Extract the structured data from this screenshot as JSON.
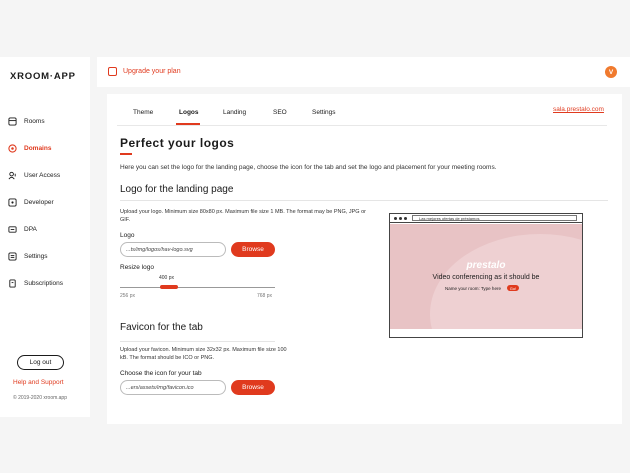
{
  "app": {
    "logo": "XROOM·APP",
    "copyright": "© 2019-2020 xroom.app"
  },
  "sidebar": {
    "items": [
      {
        "label": "Rooms",
        "icon": "rooms-icon",
        "active": false
      },
      {
        "label": "Domains",
        "icon": "domains-icon",
        "active": true
      },
      {
        "label": "User Access",
        "icon": "user-access-icon",
        "active": false
      },
      {
        "label": "Developer",
        "icon": "developer-icon",
        "active": false
      },
      {
        "label": "DPA",
        "icon": "dpa-icon",
        "active": false
      },
      {
        "label": "Settings",
        "icon": "settings-icon",
        "active": false
      },
      {
        "label": "Subscriptions",
        "icon": "subscriptions-icon",
        "active": false
      }
    ],
    "logout_label": "Log out",
    "help_label": "Help and Support"
  },
  "topbar": {
    "upgrade_label": "Upgrade your plan",
    "avatar_initial": "V"
  },
  "tabs": {
    "items": [
      "Theme",
      "Logos",
      "Landing",
      "SEO",
      "Settings"
    ],
    "active": "Logos",
    "domain_link": "sala.prestalo.com"
  },
  "main": {
    "title": "Perfect your logos",
    "intro": "Here you can set the logo for the landing page, choose the icon for the tab and set the logo and placement for your meeting rooms.",
    "landing": {
      "heading": "Logo for the landing page",
      "description": "Upload your logo. Minimum size 80x80 px. Maximum file size 1 MB. The format may be PNG, JPG or GIF.",
      "field_label": "Logo",
      "field_value": "...ts/img/logos/hav-logo.svg",
      "browse_label": "Browse",
      "resize_label": "Resize logo",
      "resize_value": "400 px",
      "resize_min": "256 px",
      "resize_max": "768 px",
      "resize_fraction": 0.29
    },
    "favicon": {
      "heading": "Favicon for the tab",
      "description": "Upload your favicon. Minimum size 32x32 px. Maximum file size 100 kB. The format should be ICO or PNG.",
      "field_label": "Choose the icon for your tab",
      "field_value": "...ers/assets/img/favicon.ico",
      "browse_label": "Browse"
    },
    "preview": {
      "url_text": "Las mejores ofertas de préstamos",
      "brand": "prestalo",
      "tagline": "Video conferencing as it should be",
      "prompt": "Name your room: Type here",
      "go_label": "Go!"
    }
  },
  "colors": {
    "accent": "#e03a1e",
    "preview_bg": "#e8c3c5",
    "avatar": "#f07a2e"
  }
}
